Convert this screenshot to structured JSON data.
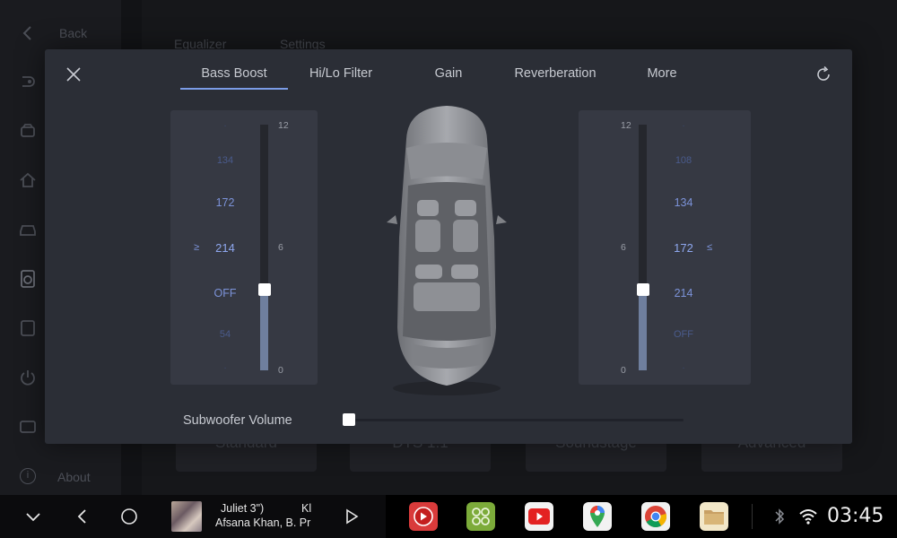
{
  "background": {
    "back_label": "Back",
    "about_label": "About",
    "tabs": [
      "Equalizer",
      "Settings"
    ],
    "cards": [
      "Standard",
      "DTS 1:1",
      "Soundstage",
      "Advanced"
    ]
  },
  "modal": {
    "tabs": [
      {
        "label": "Bass Boost",
        "active": true
      },
      {
        "label": "Hi/Lo Filter",
        "active": false
      },
      {
        "label": "Gain",
        "active": false
      },
      {
        "label": "Reverberation",
        "active": false
      },
      {
        "label": "More",
        "active": false
      }
    ],
    "left_panel": {
      "frequencies": [
        "134",
        "172",
        "214",
        "OFF",
        "54"
      ],
      "selected_frequency": "214",
      "selector_symbol": "≥",
      "scale": {
        "max": "12",
        "mid": "6",
        "min": "0"
      },
      "level": 6,
      "level_fraction": 0.33
    },
    "right_panel": {
      "frequencies": [
        "108",
        "134",
        "172",
        "214",
        "OFF"
      ],
      "selected_frequency": "172",
      "selector_symbol": "≤",
      "scale": {
        "max": "12",
        "mid": "6",
        "min": "0"
      },
      "level": 6,
      "level_fraction": 0.33
    },
    "subwoofer": {
      "label": "Subwoofer Volume",
      "value_fraction": 0.0
    }
  },
  "bottom_bar": {
    "now_playing": {
      "title": "Juliet 3\")",
      "title_suffix": "Kl",
      "artist": "Afsana Khan, B. Pr"
    },
    "apps": [
      "youtube-music-icon",
      "app-drawer-icon",
      "youtube-icon",
      "maps-icon",
      "chrome-icon",
      "files-icon"
    ],
    "clock": "03:45"
  },
  "colors": {
    "accent": "#7b9ce6",
    "frequency_blue": "#6d84c8",
    "panel_bg": "#2b2e36"
  }
}
